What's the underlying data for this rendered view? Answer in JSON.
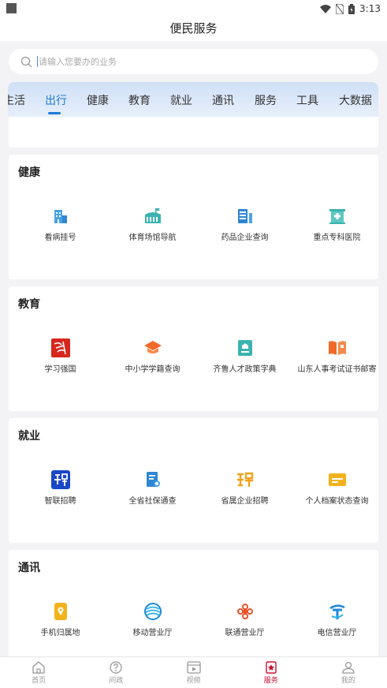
{
  "status_bar": {
    "time": "3:13"
  },
  "header": {
    "title": "便民服务"
  },
  "search": {
    "placeholder": "请输入您要办的业务"
  },
  "tabs": [
    {
      "label": "生活",
      "active": false
    },
    {
      "label": "出行",
      "active": true
    },
    {
      "label": "健康",
      "active": false
    },
    {
      "label": "教育",
      "active": false
    },
    {
      "label": "就业",
      "active": false
    },
    {
      "label": "通讯",
      "active": false
    },
    {
      "label": "服务",
      "active": false
    },
    {
      "label": "工具",
      "active": false
    },
    {
      "label": "大数据",
      "active": false
    }
  ],
  "sections": [
    {
      "title": "健康",
      "items": [
        {
          "label": "看病挂号",
          "icon": "hospital-building-icon"
        },
        {
          "label": "体育场馆导航",
          "icon": "stadium-icon"
        },
        {
          "label": "药品企业查询",
          "icon": "medicine-company-icon"
        },
        {
          "label": "重点专科医院",
          "icon": "hospital-icon"
        }
      ]
    },
    {
      "title": "教育",
      "items": [
        {
          "label": "学习强国",
          "icon": "xuexi-qiangguo-logo"
        },
        {
          "label": "中小学学籍查询",
          "icon": "graduation-cap-icon"
        },
        {
          "label": "齐鲁人才政策字典",
          "icon": "policy-book-icon"
        },
        {
          "label": "山东人事考试证书邮寄",
          "icon": "open-book-icon"
        }
      ]
    },
    {
      "title": "就业",
      "items": [
        {
          "label": "智联招聘",
          "icon": "zhilian-logo"
        },
        {
          "label": "全省社保通查",
          "icon": "social-security-icon"
        },
        {
          "label": "省属企业招聘",
          "icon": "recruit-icon"
        },
        {
          "label": "个人档案状态查询",
          "icon": "card-icon"
        }
      ]
    },
    {
      "title": "通讯",
      "items": [
        {
          "label": "手机归属地",
          "icon": "phone-location-icon"
        },
        {
          "label": "移动营业厅",
          "icon": "china-mobile-logo"
        },
        {
          "label": "联通营业厅",
          "icon": "china-unicom-logo"
        },
        {
          "label": "电信营业厅",
          "icon": "china-telecom-logo"
        }
      ]
    }
  ],
  "bottom_nav": [
    {
      "label": "首页",
      "icon": "home-icon",
      "active": false
    },
    {
      "label": "问政",
      "icon": "question-icon",
      "active": false
    },
    {
      "label": "视频",
      "icon": "video-icon",
      "active": false
    },
    {
      "label": "服务",
      "icon": "service-icon",
      "active": true
    },
    {
      "label": "我的",
      "icon": "user-icon",
      "active": false
    }
  ],
  "colors": {
    "accent": "#1e7ad6",
    "active_nav": "#c8102e"
  }
}
